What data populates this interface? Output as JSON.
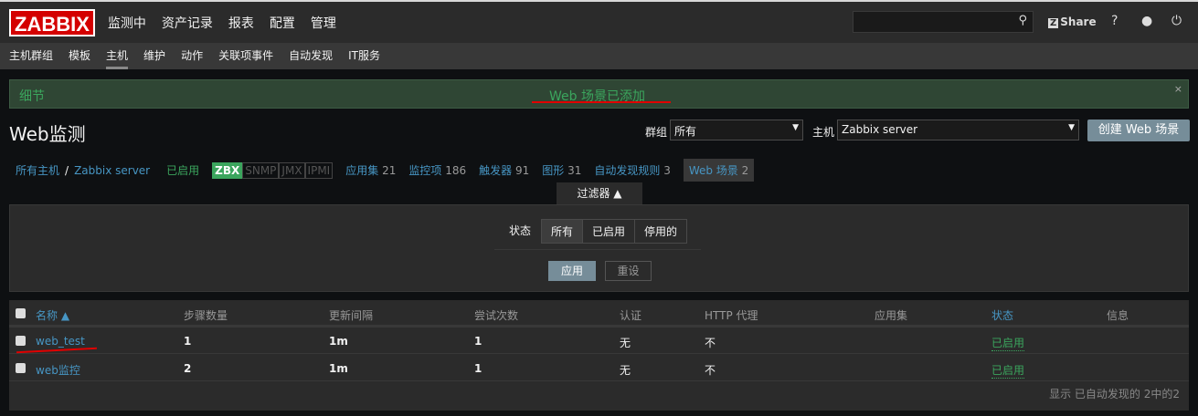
{
  "top": {
    "logo": "ZABBIX",
    "menu": [
      "监测中",
      "资产记录",
      "报表",
      "配置",
      "管理"
    ],
    "search_placeholder": "",
    "share": "Share",
    "share_badge": "Z",
    "help": "?"
  },
  "submenu": [
    "主机群组",
    "模板",
    "主机",
    "维护",
    "动作",
    "关联项事件",
    "自动发现",
    "IT服务"
  ],
  "message": {
    "details": "细节",
    "text": "Web 场景已添加",
    "close": "×"
  },
  "page": {
    "title": "Web监测",
    "group_label": "群组",
    "group_value": "所有",
    "host_label": "主机",
    "host_value": "Zabbix server",
    "create_button": "创建 Web 场景"
  },
  "breadcrumb": {
    "all_hosts": "所有主机",
    "sep": "/",
    "host": "Zabbix server",
    "status": "已启用",
    "tags": [
      "ZBX",
      "SNMP",
      "JMX",
      "IPMI"
    ],
    "links": [
      {
        "label": "应用集",
        "count": "21"
      },
      {
        "label": "监控项",
        "count": "186"
      },
      {
        "label": "触发器",
        "count": "91"
      },
      {
        "label": "图形",
        "count": "31"
      },
      {
        "label": "自动发现规则",
        "count": "3"
      },
      {
        "label": "Web 场景",
        "count": "2"
      }
    ]
  },
  "filter": {
    "tab": "过滤器 ▲",
    "status_label": "状态",
    "options": [
      "所有",
      "已启用",
      "停用的"
    ],
    "apply": "应用",
    "reset": "重设"
  },
  "table": {
    "headers": [
      "名称 ▲",
      "步骤数量",
      "更新间隔",
      "尝试次数",
      "认证",
      "HTTP 代理",
      "应用集",
      "状态",
      "信息"
    ],
    "rows": [
      [
        "web_test",
        "1",
        "1m",
        "1",
        "无",
        "不",
        "",
        "已启用",
        ""
      ],
      [
        "web监控",
        "2",
        "1m",
        "1",
        "无",
        "不",
        "",
        "已启用",
        ""
      ]
    ],
    "footer": "显示 已自动发现的 2中的2"
  }
}
